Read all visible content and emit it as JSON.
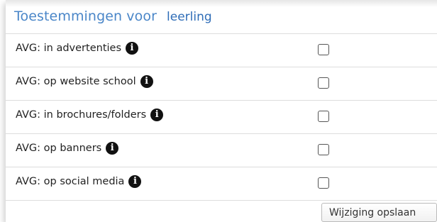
{
  "header": {
    "title": "Toestemmingen voor",
    "subject": "leerling"
  },
  "rows": [
    {
      "label": "AVG: in advertenties",
      "checked": false
    },
    {
      "label": "AVG: op website school",
      "checked": false
    },
    {
      "label": "AVG: in brochures/folders",
      "checked": false
    },
    {
      "label": "AVG: op banners",
      "checked": false
    },
    {
      "label": "AVG: op social media",
      "checked": false
    }
  ],
  "info_icon": {
    "glyph": "i",
    "icon": "info-icon"
  },
  "save_button": {
    "label": "Wijziging opslaan"
  },
  "colors": {
    "title": "#4a86c8",
    "subject": "#2f6db7",
    "border": "#dddddd"
  }
}
